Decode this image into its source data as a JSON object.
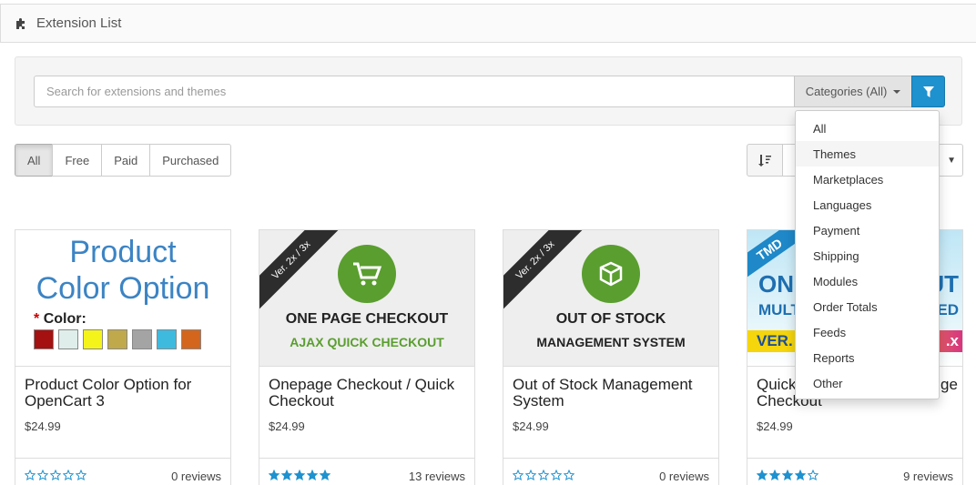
{
  "header": {
    "title": "Extension List",
    "icon": "puzzle-icon"
  },
  "search": {
    "placeholder": "Search for extensions and themes",
    "category_label": "Categories (All)",
    "filter_icon": "filter-icon"
  },
  "filters": {
    "items": [
      "All",
      "Free",
      "Paid",
      "Purchased"
    ],
    "active": "All"
  },
  "sort": {
    "icon": "sort-icon"
  },
  "category_menu": {
    "items": [
      "All",
      "Themes",
      "Marketplaces",
      "Languages",
      "Payment",
      "Shipping",
      "Modules",
      "Order Totals",
      "Feeds",
      "Reports",
      "Other"
    ],
    "hovered": "Themes"
  },
  "cards": [
    {
      "thumb": {
        "title_line1": "Product",
        "title_line2": "Color Option",
        "color_label": "Color:",
        "swatches": [
          "#a51010",
          "#dfeeea",
          "#f4f41a",
          "#c0a94a",
          "#a4a4a4",
          "#3fbadf",
          "#d4651c"
        ]
      },
      "name": "Product Color Option for OpenCart 3",
      "price": "$24.99",
      "rating": 0,
      "reviews": "0 reviews"
    },
    {
      "thumb": {
        "ribbon": "Ver. 2x / 3x",
        "line1": "ONE PAGE CHECKOUT",
        "line2": "AJAX QUICK CHECKOUT",
        "icon": "cart-icon"
      },
      "name": "Onepage Checkout / Quick Checkout",
      "price": "$24.99",
      "rating": 5,
      "reviews": "13 reviews"
    },
    {
      "thumb": {
        "ribbon": "Ver. 2x / 3x",
        "line1": "OUT OF STOCK",
        "line2": "MANAGEMENT SYSTEM",
        "icon": "box-icon"
      },
      "name": "Out of Stock Management System",
      "price": "$24.99",
      "rating": 0,
      "reviews": "0 reviews"
    },
    {
      "thumb": {
        "badge": "TMD",
        "line1": "ON",
        "line1_right": "UT",
        "line2": "MULT",
        "line2_right": "TED",
        "line3": "VER.",
        "line3_right": ".x"
      },
      "name_start": "Quick",
      "name_end": "ge",
      "name_line2": "Checkout",
      "price": "$24.99",
      "rating": 4,
      "reviews": "9 reviews"
    }
  ],
  "colors": {
    "accent": "#1e91cf",
    "star": "#1e91cf",
    "green": "#5a9e2f"
  }
}
